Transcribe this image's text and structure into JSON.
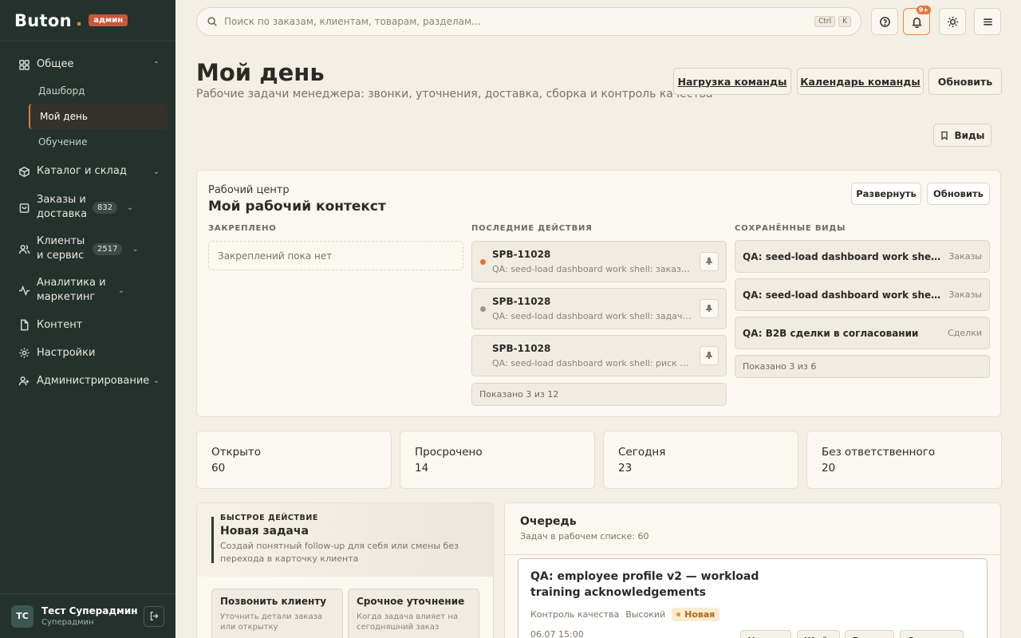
{
  "brand": {
    "name": "Buton",
    "role_badge": "админ"
  },
  "sidebar": {
    "sections": [
      {
        "label": "Общее",
        "icon": "grid-icon",
        "expanded": true,
        "items": [
          {
            "label": "Дашборд"
          },
          {
            "label": "Мой день",
            "active": true
          },
          {
            "label": "Обучение"
          }
        ]
      },
      {
        "label": "Каталог и склад",
        "icon": "box-icon"
      },
      {
        "label": "Заказы и доставка",
        "icon": "cart-icon",
        "count": "832"
      },
      {
        "label": "Клиенты и сервис",
        "icon": "users-icon",
        "count": "2517"
      },
      {
        "label": "Аналитика и маркетинг",
        "icon": "pulse-icon"
      },
      {
        "label": "Контент",
        "icon": "file-icon"
      },
      {
        "label": "Настройки",
        "icon": "gear-icon"
      },
      {
        "label": "Администрирование",
        "icon": "admin-icon"
      }
    ]
  },
  "user": {
    "initials": "ТС",
    "name": "Тест Суперадмин",
    "role": "Суперадмин"
  },
  "search": {
    "placeholder": "Поиск по заказам, клиентам, товарам, разделам...",
    "kbd1": "Ctrl",
    "kbd2": "K"
  },
  "notifications": {
    "count": "9+"
  },
  "header": {
    "title": "Мой день",
    "subtitle": "Рабочие задачи менеджера: звонки, уточнения, доставка, сборка и контроль качества",
    "btn_load": "Нагрузка команды",
    "btn_calendar": "Календарь команды",
    "btn_refresh": "Обновить",
    "btn_views": "Виды"
  },
  "workcenter": {
    "kicker": "Рабочий центр",
    "title": "Мой рабочий контекст",
    "btn_expand": "Развернуть",
    "btn_refresh": "Обновить",
    "pinned_title": "ЗАКРЕПЛЕНО",
    "pinned_empty": "Закреплений пока нет",
    "recent_title": "ПОСЛЕДНИЕ ДЕЙСТВИЯ",
    "recent": [
      {
        "code": "SPB-11028",
        "desc": "QA: seed-load dashboard work shell: заказ требует",
        "dot": "#e0782f"
      },
      {
        "code": "SPB-11028",
        "desc": "QA: seed-load dashboard work shell: задача в работе",
        "dot": "#9c968b"
      },
      {
        "code": "SPB-11028",
        "desc": "QA: seed-load dashboard work shell: риск остатка",
        "dot": ""
      }
    ],
    "recent_shown": "Показано 3 из 12",
    "views_title": "СОХРАНЁННЫЕ ВИДЫ",
    "views": [
      {
        "title": "QA: seed-load dashboard work shell: срочные",
        "kind": "Заказы"
      },
      {
        "title": "QA: seed-load dashboard work shell: срочные",
        "kind": "Заказы"
      },
      {
        "title": "QA: B2B сделки в согласовании",
        "kind": "Сделки"
      }
    ],
    "views_shown": "Показано 3 из 6"
  },
  "stats": [
    {
      "label": "Открыто",
      "value": "60"
    },
    {
      "label": "Просрочено",
      "value": "14"
    },
    {
      "label": "Сегодня",
      "value": "23"
    },
    {
      "label": "Без ответственного",
      "value": "20"
    }
  ],
  "quick": {
    "kicker": "БЫСТРОЕ ДЕЙСТВИЕ",
    "title": "Новая задача",
    "desc": "Создай понятный follow-up для себя или смены без перехода в карточку клиента",
    "cards": [
      {
        "title": "Позвонить клиенту",
        "desc": "Уточнить детали заказа или открытку"
      },
      {
        "title": "Срочное уточнение",
        "desc": "Когда задача влияет на сегодняшний заказ"
      }
    ]
  },
  "queue": {
    "title": "Очередь",
    "subtitle": "Задач в рабочем списке: 60",
    "task": {
      "title": "QA: employee profile v2 — workload training acknowledgements",
      "category": "Контроль качества",
      "priority": "Высокий",
      "status": "Новая",
      "date": "06.07 15:00",
      "actions": [
        "Начать",
        "Ждёт",
        "Готово",
        "Отменить"
      ]
    }
  }
}
